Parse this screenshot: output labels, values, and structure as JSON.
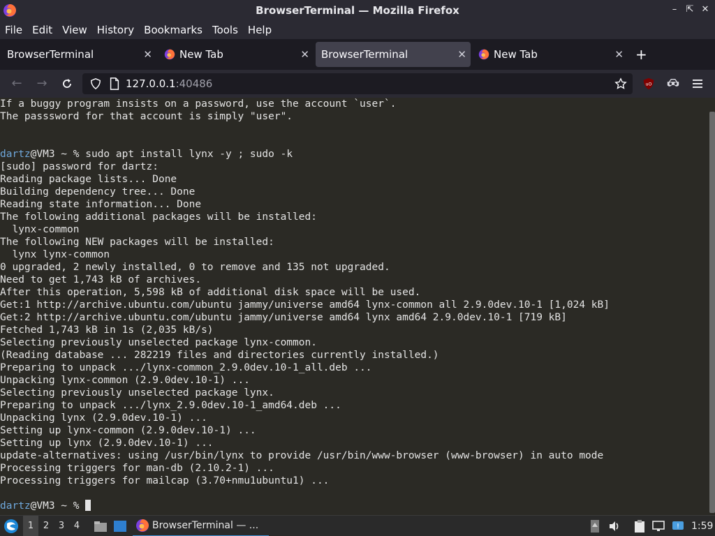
{
  "window": {
    "title": "BrowserTerminal — Mozilla Firefox"
  },
  "menu": [
    "File",
    "Edit",
    "View",
    "History",
    "Bookmarks",
    "Tools",
    "Help"
  ],
  "tabs": [
    {
      "label": "BrowserTerminal",
      "active": false,
      "has_icon": false
    },
    {
      "label": "New Tab",
      "active": false,
      "has_icon": true
    },
    {
      "label": "BrowserTerminal",
      "active": true,
      "has_icon": false
    },
    {
      "label": "New Tab",
      "active": false,
      "has_icon": true
    }
  ],
  "newtab_label": "+",
  "url": {
    "host": "127.0.0.1",
    "port": ":40486"
  },
  "terminal": {
    "lines": [
      "If a buggy program insists on a password, use the account `user`.",
      "The passsword for that account is simply \"user\".",
      "",
      "",
      "%%PROMPT%%sudo apt install lynx -y ; sudo -k",
      "[sudo] password for dartz:",
      "Reading package lists... Done",
      "Building dependency tree... Done",
      "Reading state information... Done",
      "The following additional packages will be installed:",
      "  lynx-common",
      "The following NEW packages will be installed:",
      "  lynx lynx-common",
      "0 upgraded, 2 newly installed, 0 to remove and 135 not upgraded.",
      "Need to get 1,743 kB of archives.",
      "After this operation, 5,598 kB of additional disk space will be used.",
      "Get:1 http://archive.ubuntu.com/ubuntu jammy/universe amd64 lynx-common all 2.9.0dev.10-1 [1,024 kB]",
      "Get:2 http://archive.ubuntu.com/ubuntu jammy/universe amd64 lynx amd64 2.9.0dev.10-1 [719 kB]",
      "Fetched 1,743 kB in 1s (2,035 kB/s)",
      "Selecting previously unselected package lynx-common.",
      "(Reading database ... 282219 files and directories currently installed.)",
      "Preparing to unpack .../lynx-common_2.9.0dev.10-1_all.deb ...",
      "Unpacking lynx-common (2.9.0dev.10-1) ...",
      "Selecting previously unselected package lynx.",
      "Preparing to unpack .../lynx_2.9.0dev.10-1_amd64.deb ...",
      "Unpacking lynx (2.9.0dev.10-1) ...",
      "Setting up lynx-common (2.9.0dev.10-1) ...",
      "Setting up lynx (2.9.0dev.10-1) ...",
      "update-alternatives: using /usr/bin/lynx to provide /usr/bin/www-browser (www-browser) in auto mode",
      "Processing triggers for man-db (2.10.2-1) ...",
      "Processing triggers for mailcap (3.70+nmu1ubuntu1) ...",
      "",
      "%%PROMPT%%"
    ],
    "prompt_user": "dartz",
    "prompt_rest": "@VM3 ~ % "
  },
  "taskbar": {
    "workspaces": [
      "1",
      "2",
      "3",
      "4"
    ],
    "window_label": "BrowserTerminal — ...",
    "clock": "1:59"
  },
  "colors": {
    "accent": "#3f8fd2",
    "terminal_bg": "#2b2a25",
    "prompt_user": "#6fa8dc"
  }
}
